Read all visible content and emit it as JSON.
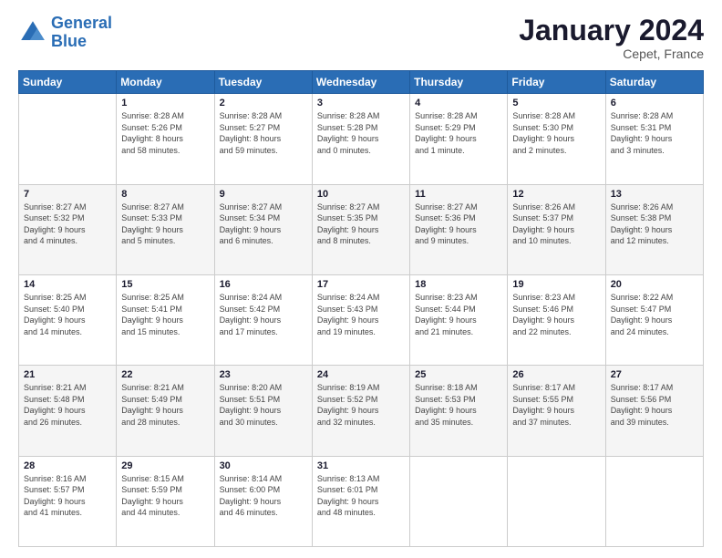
{
  "header": {
    "logo_line1": "General",
    "logo_line2": "Blue",
    "title": "January 2024",
    "subtitle": "Cepet, France"
  },
  "calendar": {
    "days_of_week": [
      "Sunday",
      "Monday",
      "Tuesday",
      "Wednesday",
      "Thursday",
      "Friday",
      "Saturday"
    ],
    "weeks": [
      [
        {
          "day": "",
          "info": ""
        },
        {
          "day": "1",
          "info": "Sunrise: 8:28 AM\nSunset: 5:26 PM\nDaylight: 8 hours\nand 58 minutes."
        },
        {
          "day": "2",
          "info": "Sunrise: 8:28 AM\nSunset: 5:27 PM\nDaylight: 8 hours\nand 59 minutes."
        },
        {
          "day": "3",
          "info": "Sunrise: 8:28 AM\nSunset: 5:28 PM\nDaylight: 9 hours\nand 0 minutes."
        },
        {
          "day": "4",
          "info": "Sunrise: 8:28 AM\nSunset: 5:29 PM\nDaylight: 9 hours\nand 1 minute."
        },
        {
          "day": "5",
          "info": "Sunrise: 8:28 AM\nSunset: 5:30 PM\nDaylight: 9 hours\nand 2 minutes."
        },
        {
          "day": "6",
          "info": "Sunrise: 8:28 AM\nSunset: 5:31 PM\nDaylight: 9 hours\nand 3 minutes."
        }
      ],
      [
        {
          "day": "7",
          "info": "Sunrise: 8:27 AM\nSunset: 5:32 PM\nDaylight: 9 hours\nand 4 minutes."
        },
        {
          "day": "8",
          "info": "Sunrise: 8:27 AM\nSunset: 5:33 PM\nDaylight: 9 hours\nand 5 minutes."
        },
        {
          "day": "9",
          "info": "Sunrise: 8:27 AM\nSunset: 5:34 PM\nDaylight: 9 hours\nand 6 minutes."
        },
        {
          "day": "10",
          "info": "Sunrise: 8:27 AM\nSunset: 5:35 PM\nDaylight: 9 hours\nand 8 minutes."
        },
        {
          "day": "11",
          "info": "Sunrise: 8:27 AM\nSunset: 5:36 PM\nDaylight: 9 hours\nand 9 minutes."
        },
        {
          "day": "12",
          "info": "Sunrise: 8:26 AM\nSunset: 5:37 PM\nDaylight: 9 hours\nand 10 minutes."
        },
        {
          "day": "13",
          "info": "Sunrise: 8:26 AM\nSunset: 5:38 PM\nDaylight: 9 hours\nand 12 minutes."
        }
      ],
      [
        {
          "day": "14",
          "info": "Sunrise: 8:25 AM\nSunset: 5:40 PM\nDaylight: 9 hours\nand 14 minutes."
        },
        {
          "day": "15",
          "info": "Sunrise: 8:25 AM\nSunset: 5:41 PM\nDaylight: 9 hours\nand 15 minutes."
        },
        {
          "day": "16",
          "info": "Sunrise: 8:24 AM\nSunset: 5:42 PM\nDaylight: 9 hours\nand 17 minutes."
        },
        {
          "day": "17",
          "info": "Sunrise: 8:24 AM\nSunset: 5:43 PM\nDaylight: 9 hours\nand 19 minutes."
        },
        {
          "day": "18",
          "info": "Sunrise: 8:23 AM\nSunset: 5:44 PM\nDaylight: 9 hours\nand 21 minutes."
        },
        {
          "day": "19",
          "info": "Sunrise: 8:23 AM\nSunset: 5:46 PM\nDaylight: 9 hours\nand 22 minutes."
        },
        {
          "day": "20",
          "info": "Sunrise: 8:22 AM\nSunset: 5:47 PM\nDaylight: 9 hours\nand 24 minutes."
        }
      ],
      [
        {
          "day": "21",
          "info": "Sunrise: 8:21 AM\nSunset: 5:48 PM\nDaylight: 9 hours\nand 26 minutes."
        },
        {
          "day": "22",
          "info": "Sunrise: 8:21 AM\nSunset: 5:49 PM\nDaylight: 9 hours\nand 28 minutes."
        },
        {
          "day": "23",
          "info": "Sunrise: 8:20 AM\nSunset: 5:51 PM\nDaylight: 9 hours\nand 30 minutes."
        },
        {
          "day": "24",
          "info": "Sunrise: 8:19 AM\nSunset: 5:52 PM\nDaylight: 9 hours\nand 32 minutes."
        },
        {
          "day": "25",
          "info": "Sunrise: 8:18 AM\nSunset: 5:53 PM\nDaylight: 9 hours\nand 35 minutes."
        },
        {
          "day": "26",
          "info": "Sunrise: 8:17 AM\nSunset: 5:55 PM\nDaylight: 9 hours\nand 37 minutes."
        },
        {
          "day": "27",
          "info": "Sunrise: 8:17 AM\nSunset: 5:56 PM\nDaylight: 9 hours\nand 39 minutes."
        }
      ],
      [
        {
          "day": "28",
          "info": "Sunrise: 8:16 AM\nSunset: 5:57 PM\nDaylight: 9 hours\nand 41 minutes."
        },
        {
          "day": "29",
          "info": "Sunrise: 8:15 AM\nSunset: 5:59 PM\nDaylight: 9 hours\nand 44 minutes."
        },
        {
          "day": "30",
          "info": "Sunrise: 8:14 AM\nSunset: 6:00 PM\nDaylight: 9 hours\nand 46 minutes."
        },
        {
          "day": "31",
          "info": "Sunrise: 8:13 AM\nSunset: 6:01 PM\nDaylight: 9 hours\nand 48 minutes."
        },
        {
          "day": "",
          "info": ""
        },
        {
          "day": "",
          "info": ""
        },
        {
          "day": "",
          "info": ""
        }
      ]
    ]
  }
}
